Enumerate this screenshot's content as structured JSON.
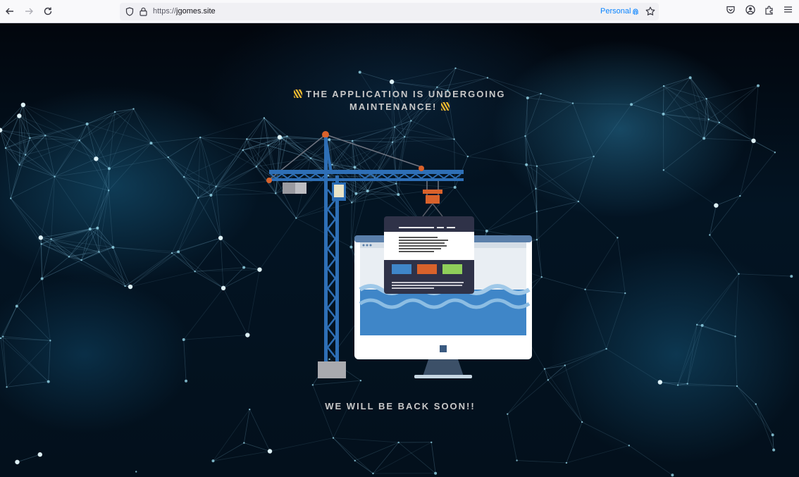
{
  "browser": {
    "url_scheme": "https://",
    "url_host": "jgomes.site",
    "container_label": "Personal",
    "icons": [
      "back-arrow-icon",
      "forward-arrow-icon",
      "reload-icon",
      "shield-icon",
      "lock-icon",
      "fingerprint-icon",
      "star-icon",
      "pocket-icon",
      "account-icon",
      "extensions-icon",
      "menu-icon"
    ]
  },
  "page": {
    "headline_line1": "THE APPLICATION IS UNDERGOING",
    "headline_line2": "MAINTENANCE!",
    "footer": "WE WILL BE BACK SOON!!",
    "emoji": "construction-sign-emoji"
  },
  "colors": {
    "crane_blue": "#2e6fb6",
    "accent_orange": "#d9622b",
    "screen_blue": "#3f86c8",
    "panel_dark": "#2f3248",
    "tile_green": "#8fcf5a",
    "text_light": "#c8c8c8",
    "container_blue": "#0a84ff"
  }
}
